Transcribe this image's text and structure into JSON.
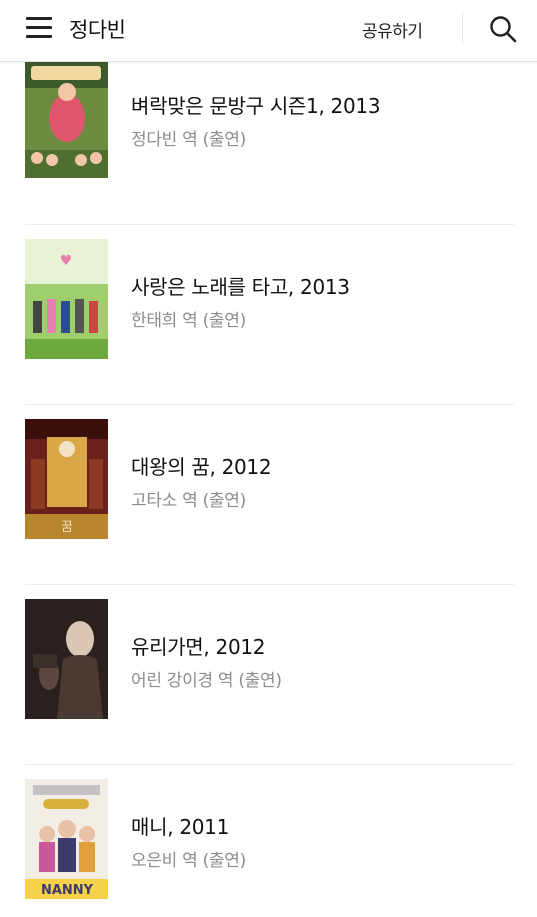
{
  "header": {
    "title": "정다빈",
    "share_label": "공유하기",
    "menu_icon": "hamburger-menu-icon",
    "search_icon": "search-icon"
  },
  "works": [
    {
      "title": "벼락맞은 문방구 시즌1, 2013",
      "role": "정다빈 역 (출연)",
      "poster_colors": [
        "#6d8b3f",
        "#e0566c",
        "#f0d9a0"
      ]
    },
    {
      "title": "사랑은 노래를 타고, 2013",
      "role": "한태희 역 (출연)",
      "poster_colors": [
        "#9fcf6c",
        "#e77fb0",
        "#f4f0ea"
      ]
    },
    {
      "title": "대왕의 꿈, 2012",
      "role": "고타소 역 (출연)",
      "poster_colors": [
        "#6b1f1a",
        "#d9a648",
        "#f3e3c4"
      ]
    },
    {
      "title": "유리가면, 2012",
      "role": "어린 강이경 역 (출연)",
      "poster_colors": [
        "#2a211e",
        "#6a5248",
        "#d9c7b4"
      ]
    },
    {
      "title": "매니, 2011",
      "role": "오은비 역 (출연)",
      "poster_colors": [
        "#f2eee6",
        "#d7b23a",
        "#3d3b6b"
      ]
    }
  ]
}
